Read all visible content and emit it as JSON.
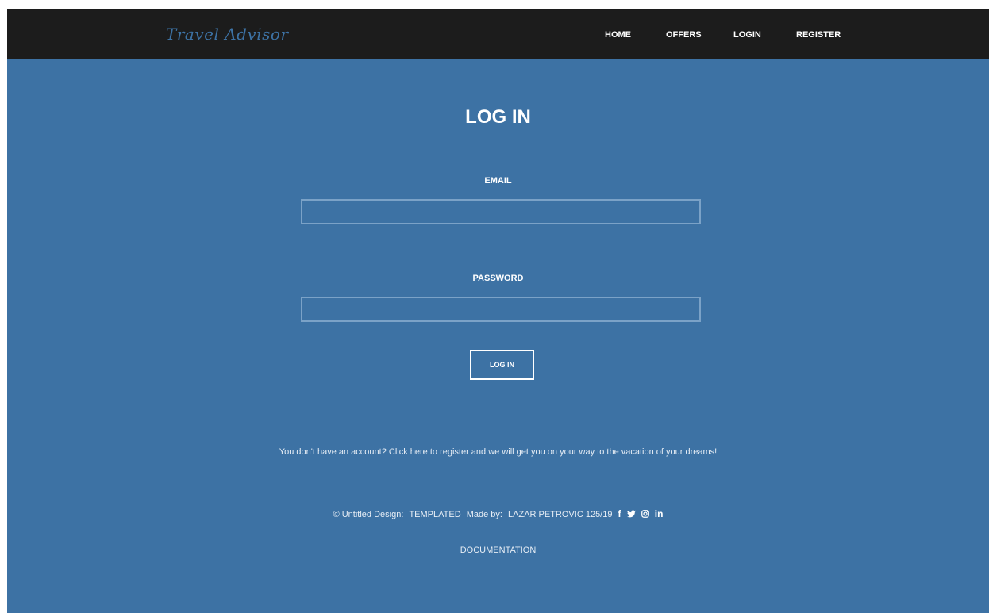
{
  "header": {
    "logo_text": "Travel Advisor",
    "nav": {
      "home": "HOME",
      "offers": "OFFERS",
      "login": "LOGIN",
      "register": "REGISTER"
    }
  },
  "login_form": {
    "title": "LOG IN",
    "email_label": "EMAIL",
    "email_value": "",
    "password_label": "PASSWORD",
    "password_value": "",
    "submit_label": "LOG IN"
  },
  "register_prompt": "You don't have an account? Click here to register and we will get you on your way to the vacation of your dreams!",
  "footer": {
    "copyright": "© Untitled Design:",
    "design_credit": "TEMPLATED",
    "made_by_label": "Made by:",
    "author": "LAZAR PETROVIC 125/19",
    "documentation": "DOCUMENTATION",
    "social_icons": [
      "facebook-icon",
      "twitter-icon",
      "instagram-icon",
      "linkedin-icon"
    ]
  },
  "colors": {
    "header_bg": "#1c1c1c",
    "page_bg": "#3d72a4",
    "logo": "#3d72a4",
    "text": "#ffffff"
  }
}
